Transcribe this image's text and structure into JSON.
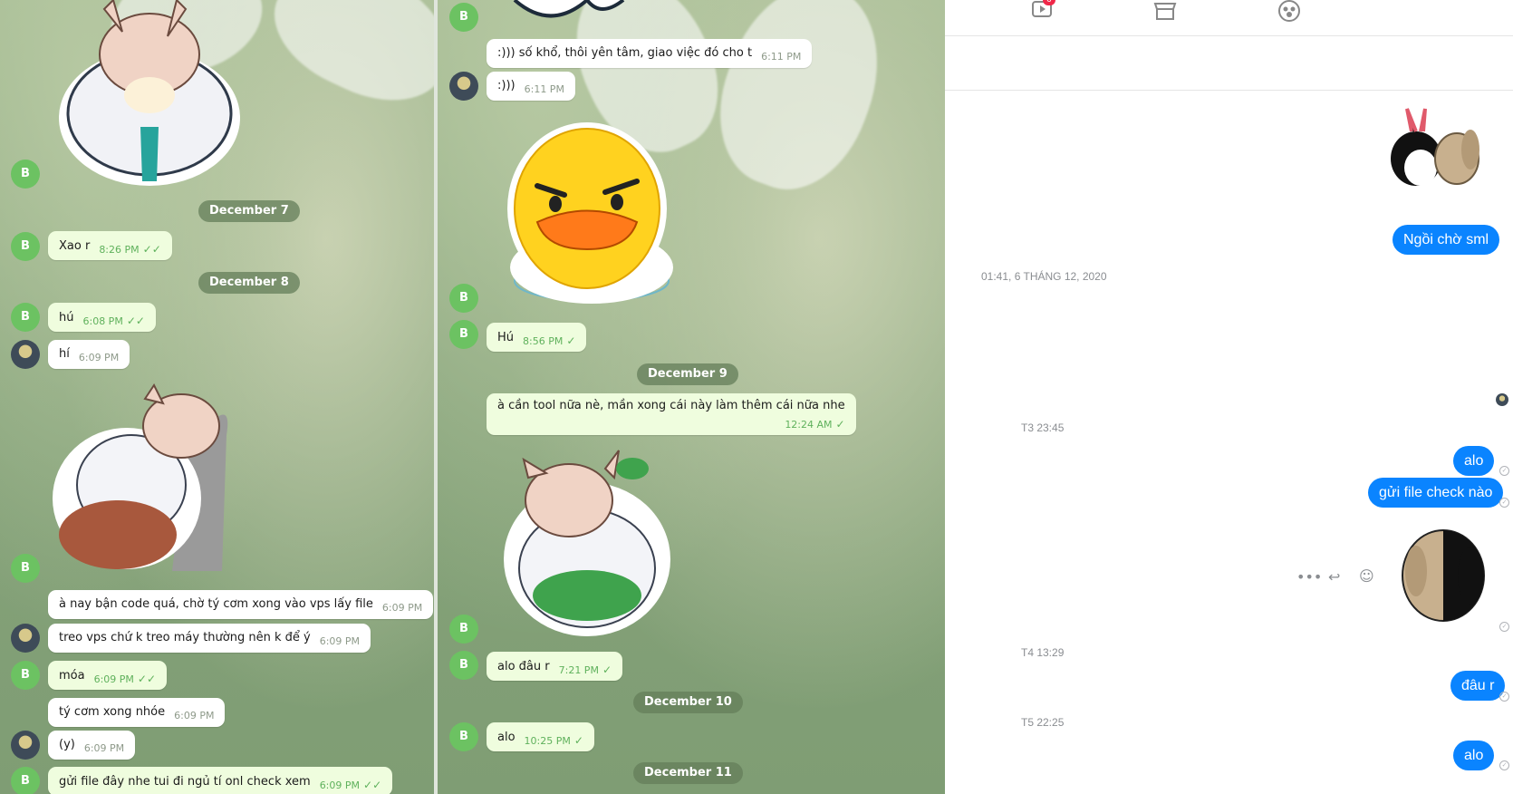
{
  "left": {
    "avatar_letter": "B",
    "dates": [
      "December 7",
      "December 8"
    ],
    "messages": [
      {
        "text": "Xao r",
        "time": "8:26 PM",
        "check": "✓✓"
      },
      {
        "text": "hú",
        "time": "6:08 PM",
        "check": "✓✓"
      },
      {
        "text": "hí",
        "time": "6:09 PM"
      },
      {
        "text": "à nay bận code quá, chờ tý cơm xong vào vps lấy file",
        "time": "6:09 PM"
      },
      {
        "text": "treo vps chứ k treo máy thường nên k để ý",
        "time": "6:09 PM"
      },
      {
        "text": "móa",
        "time": "6:09 PM",
        "check": "✓✓"
      },
      {
        "text": "tý cơm xong nhóe",
        "time": "6:09 PM"
      },
      {
        "text": "(y)",
        "time": "6:09 PM"
      },
      {
        "text": "gửi file đây nhe tui đi ngủ tí onl check xem",
        "time": "6:09 PM",
        "check": "✓✓"
      }
    ]
  },
  "middle": {
    "avatar_letter": "B",
    "dates": [
      "December 9",
      "December 10",
      "December 11"
    ],
    "messages": [
      {
        "text": ":))) số khổ, thôi yên tâm, giao việc đó cho t",
        "time": "6:11 PM"
      },
      {
        "text": ":)))",
        "time": "6:11 PM"
      },
      {
        "text": "Hú",
        "time": "8:56 PM",
        "check": "✓"
      },
      {
        "text": "à cần tool nữa nè, mần xong cái này làm thêm cái nữa nhe",
        "time": "12:24 AM",
        "check": "✓"
      },
      {
        "text": "alo đâu r",
        "time": "7:21 PM",
        "check": "✓"
      },
      {
        "text": "alo",
        "time": "10:25 PM",
        "check": "✓"
      }
    ]
  },
  "messenger": {
    "topbar": {
      "video_badge": "6",
      "icons": [
        "video-icon",
        "store-icon",
        "groups-icon"
      ]
    },
    "messages": [
      {
        "text": "Ngồi chờ sml"
      },
      {
        "text": "alo"
      },
      {
        "text": "gửi file check nào"
      },
      {
        "text": "đâu r"
      },
      {
        "text": "alo"
      }
    ],
    "timestamps": [
      "01:41, 6 THÁNG 12, 2020",
      "T3 23:45",
      "T4 13:29",
      "T5 22:25"
    ],
    "hover_actions": [
      "more-icon",
      "reply-icon",
      "react-icon"
    ],
    "colors": {
      "bubble": "#0a84ff",
      "telegram_out": "#effdde"
    }
  }
}
